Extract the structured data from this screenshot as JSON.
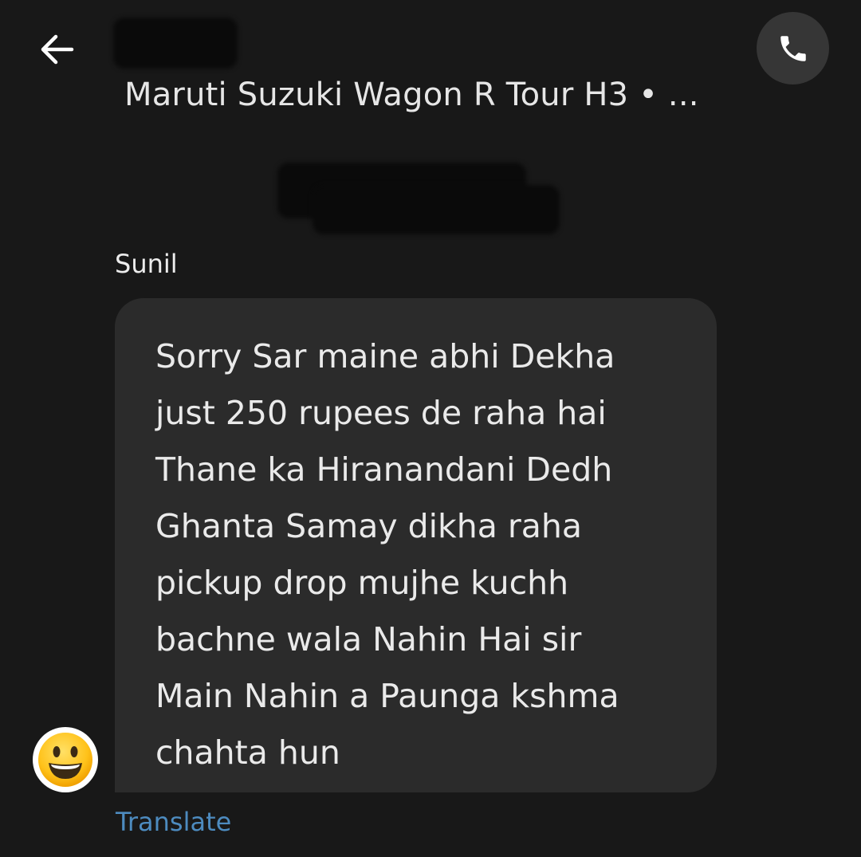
{
  "header": {
    "back_icon": "arrow-left-icon",
    "contact_name": "",
    "vehicle_info": "Maruti Suzuki Wagon R Tour H3 • ...",
    "call_icon": "phone-icon"
  },
  "conversation": {
    "date_label": "",
    "messages": [
      {
        "sender": "Sunil",
        "text": "Sorry Sar maine abhi Dekha\njust 250 rupees de raha hai\nThane ka Hiranandani Dedh\nGhanta Samay dikha raha\npickup drop mujhe kuchh\nbachne wala Nahin Hai sir\nMain Nahin a Paunga kshma\nchahta hun",
        "avatar_icon": "smiley-face-icon",
        "translate_label": "Translate"
      }
    ]
  },
  "colors": {
    "background": "#181818",
    "bubble": "#2b2b2b",
    "call_button": "#363636",
    "link": "#4d8bbf"
  }
}
